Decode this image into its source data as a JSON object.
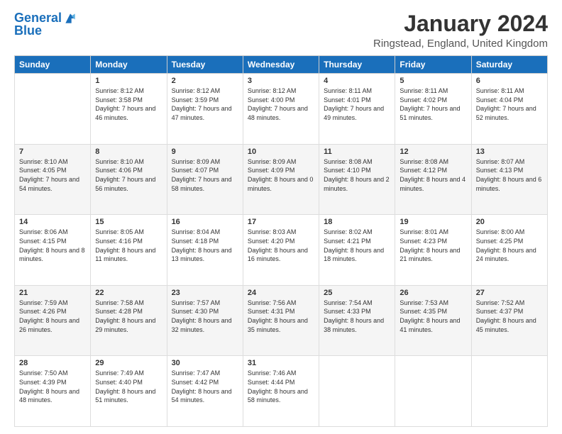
{
  "logo": {
    "line1": "General",
    "line2": "Blue"
  },
  "title": "January 2024",
  "location": "Ringstead, England, United Kingdom",
  "days_header": [
    "Sunday",
    "Monday",
    "Tuesday",
    "Wednesday",
    "Thursday",
    "Friday",
    "Saturday"
  ],
  "weeks": [
    [
      {
        "day": "",
        "sunrise": "",
        "sunset": "",
        "daylight": ""
      },
      {
        "day": "1",
        "sunrise": "Sunrise: 8:12 AM",
        "sunset": "Sunset: 3:58 PM",
        "daylight": "Daylight: 7 hours and 46 minutes."
      },
      {
        "day": "2",
        "sunrise": "Sunrise: 8:12 AM",
        "sunset": "Sunset: 3:59 PM",
        "daylight": "Daylight: 7 hours and 47 minutes."
      },
      {
        "day": "3",
        "sunrise": "Sunrise: 8:12 AM",
        "sunset": "Sunset: 4:00 PM",
        "daylight": "Daylight: 7 hours and 48 minutes."
      },
      {
        "day": "4",
        "sunrise": "Sunrise: 8:11 AM",
        "sunset": "Sunset: 4:01 PM",
        "daylight": "Daylight: 7 hours and 49 minutes."
      },
      {
        "day": "5",
        "sunrise": "Sunrise: 8:11 AM",
        "sunset": "Sunset: 4:02 PM",
        "daylight": "Daylight: 7 hours and 51 minutes."
      },
      {
        "day": "6",
        "sunrise": "Sunrise: 8:11 AM",
        "sunset": "Sunset: 4:04 PM",
        "daylight": "Daylight: 7 hours and 52 minutes."
      }
    ],
    [
      {
        "day": "7",
        "sunrise": "Sunrise: 8:10 AM",
        "sunset": "Sunset: 4:05 PM",
        "daylight": "Daylight: 7 hours and 54 minutes."
      },
      {
        "day": "8",
        "sunrise": "Sunrise: 8:10 AM",
        "sunset": "Sunset: 4:06 PM",
        "daylight": "Daylight: 7 hours and 56 minutes."
      },
      {
        "day": "9",
        "sunrise": "Sunrise: 8:09 AM",
        "sunset": "Sunset: 4:07 PM",
        "daylight": "Daylight: 7 hours and 58 minutes."
      },
      {
        "day": "10",
        "sunrise": "Sunrise: 8:09 AM",
        "sunset": "Sunset: 4:09 PM",
        "daylight": "Daylight: 8 hours and 0 minutes."
      },
      {
        "day": "11",
        "sunrise": "Sunrise: 8:08 AM",
        "sunset": "Sunset: 4:10 PM",
        "daylight": "Daylight: 8 hours and 2 minutes."
      },
      {
        "day": "12",
        "sunrise": "Sunrise: 8:08 AM",
        "sunset": "Sunset: 4:12 PM",
        "daylight": "Daylight: 8 hours and 4 minutes."
      },
      {
        "day": "13",
        "sunrise": "Sunrise: 8:07 AM",
        "sunset": "Sunset: 4:13 PM",
        "daylight": "Daylight: 8 hours and 6 minutes."
      }
    ],
    [
      {
        "day": "14",
        "sunrise": "Sunrise: 8:06 AM",
        "sunset": "Sunset: 4:15 PM",
        "daylight": "Daylight: 8 hours and 8 minutes."
      },
      {
        "day": "15",
        "sunrise": "Sunrise: 8:05 AM",
        "sunset": "Sunset: 4:16 PM",
        "daylight": "Daylight: 8 hours and 11 minutes."
      },
      {
        "day": "16",
        "sunrise": "Sunrise: 8:04 AM",
        "sunset": "Sunset: 4:18 PM",
        "daylight": "Daylight: 8 hours and 13 minutes."
      },
      {
        "day": "17",
        "sunrise": "Sunrise: 8:03 AM",
        "sunset": "Sunset: 4:20 PM",
        "daylight": "Daylight: 8 hours and 16 minutes."
      },
      {
        "day": "18",
        "sunrise": "Sunrise: 8:02 AM",
        "sunset": "Sunset: 4:21 PM",
        "daylight": "Daylight: 8 hours and 18 minutes."
      },
      {
        "day": "19",
        "sunrise": "Sunrise: 8:01 AM",
        "sunset": "Sunset: 4:23 PM",
        "daylight": "Daylight: 8 hours and 21 minutes."
      },
      {
        "day": "20",
        "sunrise": "Sunrise: 8:00 AM",
        "sunset": "Sunset: 4:25 PM",
        "daylight": "Daylight: 8 hours and 24 minutes."
      }
    ],
    [
      {
        "day": "21",
        "sunrise": "Sunrise: 7:59 AM",
        "sunset": "Sunset: 4:26 PM",
        "daylight": "Daylight: 8 hours and 26 minutes."
      },
      {
        "day": "22",
        "sunrise": "Sunrise: 7:58 AM",
        "sunset": "Sunset: 4:28 PM",
        "daylight": "Daylight: 8 hours and 29 minutes."
      },
      {
        "day": "23",
        "sunrise": "Sunrise: 7:57 AM",
        "sunset": "Sunset: 4:30 PM",
        "daylight": "Daylight: 8 hours and 32 minutes."
      },
      {
        "day": "24",
        "sunrise": "Sunrise: 7:56 AM",
        "sunset": "Sunset: 4:31 PM",
        "daylight": "Daylight: 8 hours and 35 minutes."
      },
      {
        "day": "25",
        "sunrise": "Sunrise: 7:54 AM",
        "sunset": "Sunset: 4:33 PM",
        "daylight": "Daylight: 8 hours and 38 minutes."
      },
      {
        "day": "26",
        "sunrise": "Sunrise: 7:53 AM",
        "sunset": "Sunset: 4:35 PM",
        "daylight": "Daylight: 8 hours and 41 minutes."
      },
      {
        "day": "27",
        "sunrise": "Sunrise: 7:52 AM",
        "sunset": "Sunset: 4:37 PM",
        "daylight": "Daylight: 8 hours and 45 minutes."
      }
    ],
    [
      {
        "day": "28",
        "sunrise": "Sunrise: 7:50 AM",
        "sunset": "Sunset: 4:39 PM",
        "daylight": "Daylight: 8 hours and 48 minutes."
      },
      {
        "day": "29",
        "sunrise": "Sunrise: 7:49 AM",
        "sunset": "Sunset: 4:40 PM",
        "daylight": "Daylight: 8 hours and 51 minutes."
      },
      {
        "day": "30",
        "sunrise": "Sunrise: 7:47 AM",
        "sunset": "Sunset: 4:42 PM",
        "daylight": "Daylight: 8 hours and 54 minutes."
      },
      {
        "day": "31",
        "sunrise": "Sunrise: 7:46 AM",
        "sunset": "Sunset: 4:44 PM",
        "daylight": "Daylight: 8 hours and 58 minutes."
      },
      {
        "day": "",
        "sunrise": "",
        "sunset": "",
        "daylight": ""
      },
      {
        "day": "",
        "sunrise": "",
        "sunset": "",
        "daylight": ""
      },
      {
        "day": "",
        "sunrise": "",
        "sunset": "",
        "daylight": ""
      }
    ]
  ]
}
